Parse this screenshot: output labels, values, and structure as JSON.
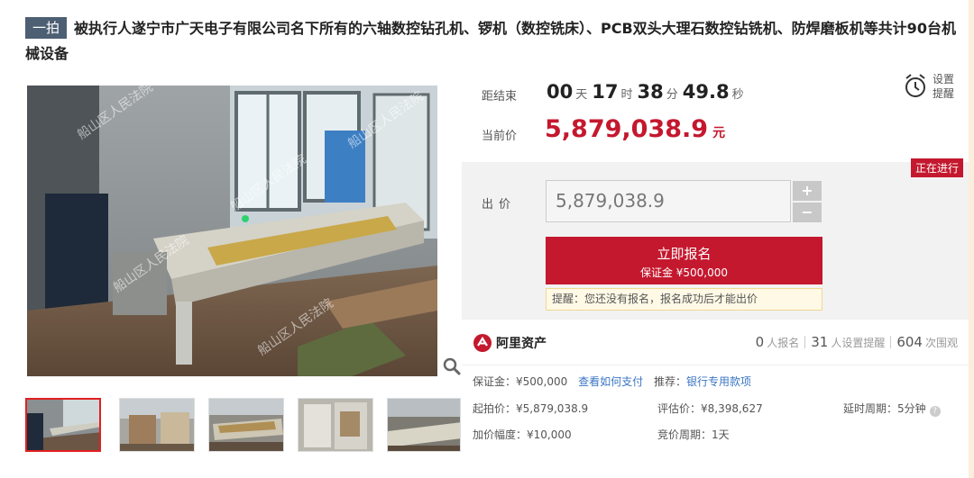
{
  "listing": {
    "badge": "一拍",
    "title": "被执行人遂宁市广天电子有限公司名下所有的六轴数控钻孔机、锣机（数控铣床）、PCB双头大理石数控钻铣机、防焊磨板机等共计90台机械设备"
  },
  "gallery": {
    "watermark": "船山区人民法院",
    "thumbnail_count": 5,
    "selected_index": 0
  },
  "countdown": {
    "label": "距结束",
    "days": "00",
    "days_unit": "天",
    "hours": "17",
    "hours_unit": "时",
    "minutes": "38",
    "minutes_unit": "分",
    "seconds": "49.8",
    "seconds_unit": "秒"
  },
  "reminder": {
    "label": "设置提醒",
    "icon": "alarm-clock-icon"
  },
  "current_price": {
    "label": "当前价",
    "value": "5,879,038.9",
    "unit": "元"
  },
  "status": "正在进行",
  "bid": {
    "label": "出价",
    "value": "5,879,038.9",
    "plus": "+",
    "minus": "−"
  },
  "register": {
    "title": "立即报名",
    "deposit": "保证金 ¥500,000"
  },
  "tip": "提醒：您还没有报名，报名成功后才能出价",
  "brand": {
    "name": "阿里资产",
    "icon": "ali-asset-logo-icon"
  },
  "stats": {
    "signups": "0",
    "signups_label": "人报名",
    "reminders": "31",
    "reminders_label": "人设置提醒",
    "views": "604",
    "views_label": "次围观"
  },
  "info": {
    "deposit_label": "保证金：¥500,000",
    "how_to_pay": "查看如何支付",
    "recommend_label": "推荐：",
    "recommend_link": "银行专用款项",
    "start_price": "起拍价：¥5,879,038.9",
    "appraised": "评估价：¥8,398,627",
    "delay": "延时周期：5分钟",
    "increment": "加价幅度：¥10,000",
    "bid_cycle": "竞价周期：1天"
  },
  "colors": {
    "accent": "#c4182e",
    "link": "#3b76c4",
    "badge": "#4d5f73"
  }
}
